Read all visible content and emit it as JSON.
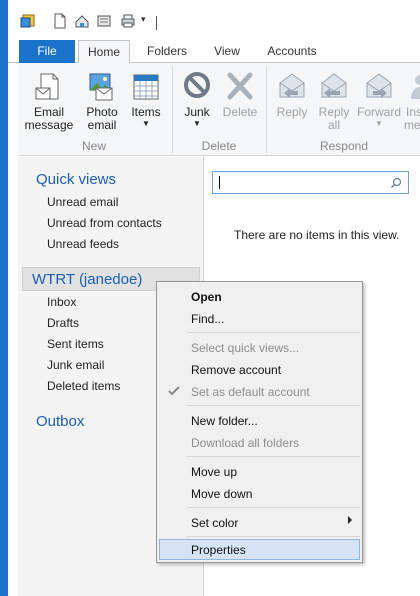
{
  "quick_access": {
    "icons": [
      "app-icon",
      "new-document-icon",
      "send-receive-icon",
      "attach-icon",
      "print-icon",
      "customize-dropdown-icon"
    ]
  },
  "tabs": [
    {
      "label": "File"
    },
    {
      "label": "Home"
    },
    {
      "label": "Folders"
    },
    {
      "label": "View"
    },
    {
      "label": "Accounts"
    }
  ],
  "ribbon": {
    "new_group": {
      "label": "New",
      "email_message": "Email message",
      "photo_email": "Photo email",
      "items": "Items"
    },
    "delete_group": {
      "label": "Delete",
      "junk": "Junk",
      "delete": "Delete"
    },
    "respond_group": {
      "label": "Respond",
      "reply": "Reply",
      "reply_all": "Reply all",
      "forward": "Forward",
      "instant_message": "Instant message"
    }
  },
  "left_pane": {
    "quick_views": {
      "title": "Quick views",
      "items": [
        "Unread email",
        "Unread from contacts",
        "Unread feeds"
      ]
    },
    "account": {
      "title": "WTRT (janedoe)",
      "items": [
        "Inbox",
        "Drafts",
        "Sent items",
        "Junk email",
        "Deleted items"
      ]
    },
    "outbox": "Outbox"
  },
  "search": {
    "value": "",
    "placeholder": ""
  },
  "message_list": {
    "empty_text": "There are no items in this view."
  },
  "context_menu": {
    "items": [
      {
        "label": "Open",
        "bold": true,
        "disabled": false
      },
      {
        "label": "Find...",
        "bold": false,
        "disabled": false
      },
      {
        "label": "Select quick views...",
        "bold": false,
        "disabled": true
      },
      {
        "label": "Remove account",
        "bold": false,
        "disabled": false
      },
      {
        "label": "Set as default account",
        "bold": false,
        "disabled": true
      },
      {
        "label": "New folder...",
        "bold": false,
        "disabled": false
      },
      {
        "label": "Download all folders",
        "bold": false,
        "disabled": true
      },
      {
        "label": "Move up",
        "bold": false,
        "disabled": false
      },
      {
        "label": "Move down",
        "bold": false,
        "disabled": false
      },
      {
        "label": "Set color",
        "bold": false,
        "disabled": false
      },
      {
        "label": "Properties",
        "bold": false,
        "disabled": false
      }
    ]
  },
  "colors": {
    "accent": "#1a73c8",
    "section_title": "#1a5fb4",
    "highlight": "#d5e3f4"
  }
}
